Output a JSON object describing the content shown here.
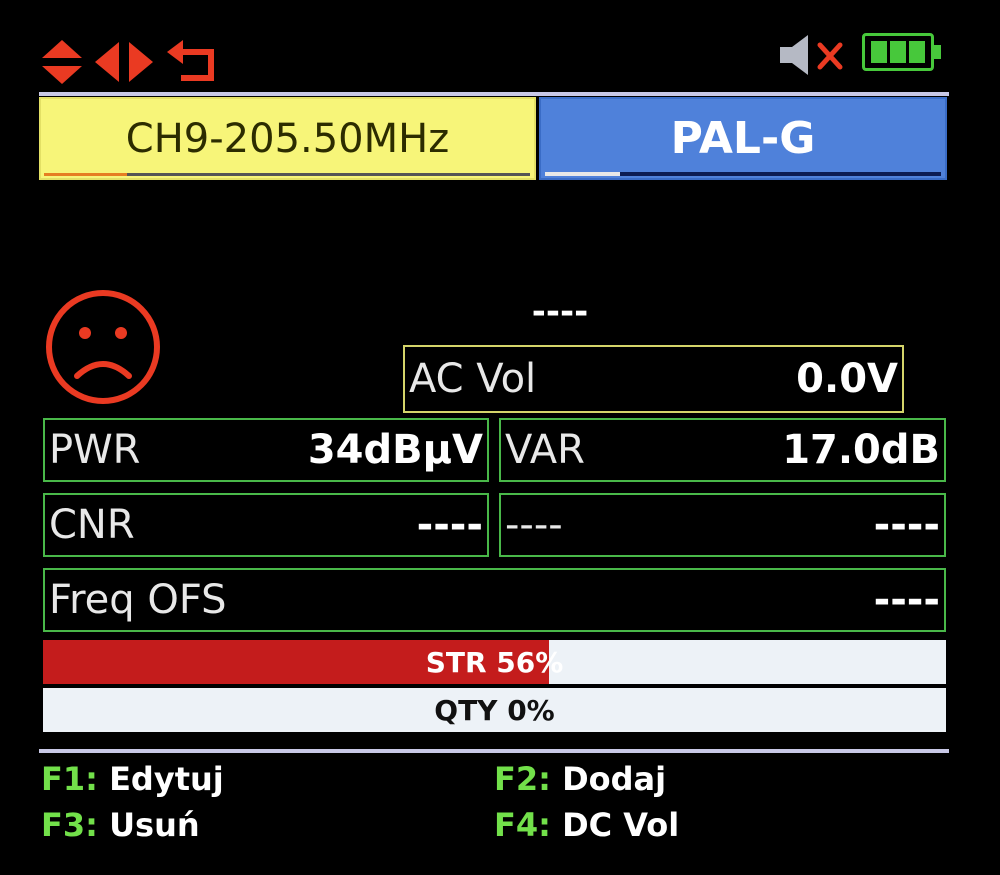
{
  "colors": {
    "accent_red": "#ea3a22",
    "frame_green": "#49b849",
    "channel_yellow": "#f7f579",
    "standard_blue": "#4f81da",
    "fkey_green": "#72e04a"
  },
  "icons": [
    "up-down-arrows-icon",
    "left-right-arrows-icon",
    "return-arrow-icon",
    "speaker-muted-icon",
    "battery-full-icon",
    "sad-face-icon"
  ],
  "header": {
    "channel": "CH9-205.50MHz",
    "channel_level": 0.17,
    "standard": "PAL-G",
    "standard_level": 0.19,
    "battery_bars": 3
  },
  "status": {
    "lock_text": "----"
  },
  "readings": {
    "ac_vol": {
      "label": "AC Vol",
      "value": "0.0V"
    },
    "pwr": {
      "label": "PWR",
      "value": "34dBµV"
    },
    "var": {
      "label": "VAR",
      "value": "17.0dB"
    },
    "cnr": {
      "label": "CNR",
      "value": "----"
    },
    "extra": {
      "label": "----",
      "value": "----"
    },
    "freq_ofs": {
      "label": "Freq OFS",
      "value": "----"
    }
  },
  "bars": {
    "str": {
      "label": "STR 56%",
      "percent": 56
    },
    "qty": {
      "label": "QTY 0%",
      "percent": 0
    }
  },
  "fkeys": [
    {
      "key": "F1:",
      "text": "Edytuj"
    },
    {
      "key": "F2:",
      "text": "Dodaj"
    },
    {
      "key": "F3:",
      "text": "Usuń"
    },
    {
      "key": "F4:",
      "text": "DC Vol"
    }
  ]
}
